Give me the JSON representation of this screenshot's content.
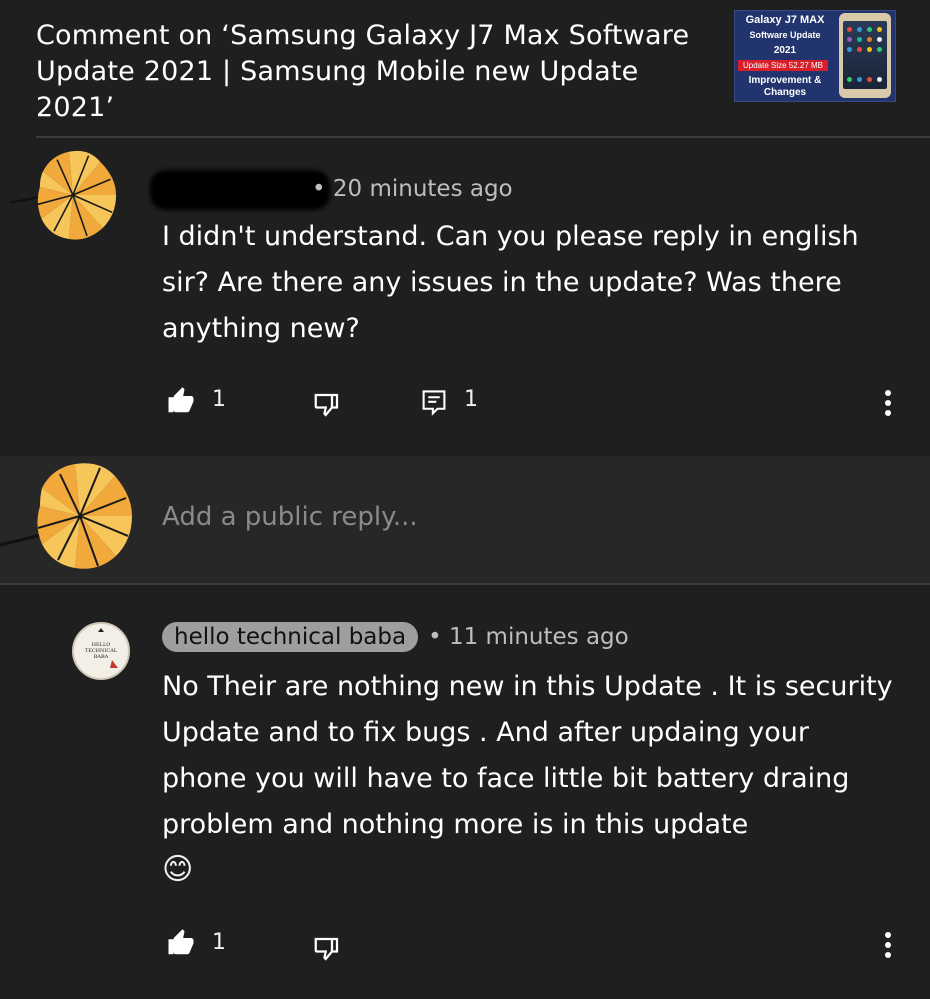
{
  "header": {
    "title": "Comment on ‘Samsung Galaxy J7 Max Software Update 2021 |  Samsung Mobile new Update 2021’",
    "thumbnail": {
      "line1": "Galaxy J7 MAX",
      "line2": "Software Update",
      "line3": "2021",
      "line4": "Update Size 52.27 MB",
      "line5": "Improvement &",
      "line6": "Changes"
    }
  },
  "comment": {
    "time": "• 20 minutes ago",
    "text": "I didn't understand. Can you please reply in english sir? Are there any issues in the update? Was there anything new?",
    "likes": "1",
    "replies": "1"
  },
  "reply_box": {
    "placeholder": "Add a public reply..."
  },
  "reply": {
    "author": "hello technical baba",
    "avatar_text": "HELLO TECHNICAL BABA",
    "time": "• 11 minutes ago",
    "text": "No Their are nothing new in this Update . It is security Update and to fix bugs . And after updaing your phone you will have to face little bit  battery draing problem and nothing more is in this update",
    "emoji": "😊",
    "likes": "1"
  },
  "colors": {
    "background": "#1f1f1f",
    "reply_band": "#272727",
    "author_chip": "#9e9e9e",
    "flower": "#f7b733"
  }
}
